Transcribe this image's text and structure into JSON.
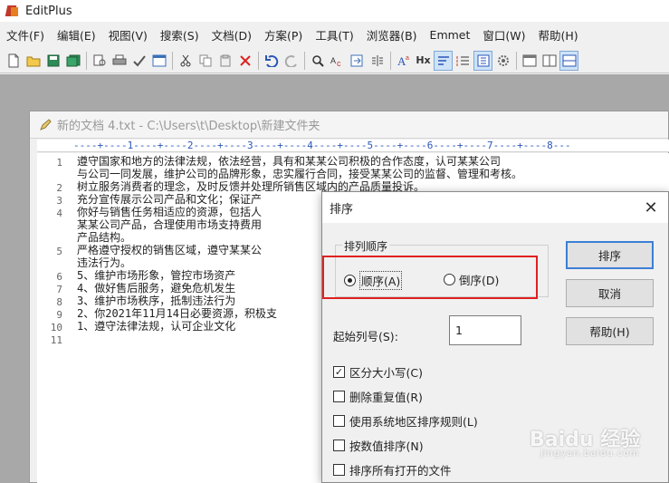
{
  "app": {
    "title": "EditPlus"
  },
  "menu": [
    "文件(F)",
    "编辑(E)",
    "视图(V)",
    "搜索(S)",
    "文档(D)",
    "方案(P)",
    "工具(T)",
    "浏览器(B)",
    "Emmet",
    "窗口(W)",
    "帮助(H)"
  ],
  "toolbar": {
    "hex_label": "Hx",
    "icons": [
      "new-file-icon",
      "open-folder-icon",
      "save-icon",
      "save-all-icon",
      "print-preview-icon",
      "print-icon",
      "spell-check-icon",
      "browser-preview-icon",
      "cut-icon",
      "copy-icon",
      "paste-icon",
      "delete-icon",
      "undo-icon",
      "redo-icon",
      "find-icon",
      "replace-icon",
      "goto-icon",
      "insert-icon",
      "font-icon",
      "hex-icon",
      "wordwrap-icon",
      "line-numbers-icon",
      "column-icon",
      "settings-icon",
      "window-1-icon",
      "window-2-icon",
      "window-3-icon"
    ]
  },
  "document": {
    "title": "新的文档 4.txt - C:\\Users\\t\\Desktop\\新建文件夹",
    "ruler": "----+----1----+----2----+----3----+----4----+----5----+----6----+----7----+----8---",
    "line_numbers": [
      "1",
      "",
      "2",
      "3",
      "4",
      "",
      "",
      "5",
      "",
      "6",
      "7",
      "8",
      "9",
      "10",
      "11"
    ],
    "lines": [
      "遵守国家和地方的法律法规，依法经营，具有和某某公司积极的合作态度，认可某某公司",
      "与公司一同发展，维护公司的品牌形象，忠实履行合同，接受某某公司的监督、管理和考核。",
      "树立服务消费者的理念，及时反馈并处理所销售区域内的产品质量投诉。",
      "充分宣传展示公司产品和文化；保证产",
      "你好与销售任务相适应的资源，包括人",
      "某某公司产品，合理使用市场支持费用",
      "产品结构。",
      "严格遵守授权的销售区域，遵守某某公",
      "违法行为。",
      "5、维护市场形象，管控市场资产",
      "4、做好售后服务，避免危机发生",
      "3、维护市场秩序，抵制违法行为",
      "2、你2021年11月14日必要资源，积极支",
      "1、遵守法律法规，认可企业文化",
      ""
    ]
  },
  "dialog": {
    "title": "排序",
    "order_group_label": "排列顺序",
    "radio_asc": "顺序(A)",
    "radio_desc": "倒序(D)",
    "selected": "asc",
    "start_column_label": "起始列号(S):",
    "start_column_value": "1",
    "buttons": {
      "sort": "排序",
      "cancel": "取消",
      "help": "帮助(H)"
    },
    "checkboxes": [
      {
        "label": "区分大小写(C)",
        "checked": true
      },
      {
        "label": "删除重复值(R)",
        "checked": false
      },
      {
        "label": "使用系统地区排序规则(L)",
        "checked": false
      },
      {
        "label": "按数值排序(N)",
        "checked": false
      },
      {
        "label": "排序所有打开的文件",
        "checked": false
      }
    ]
  },
  "watermark": {
    "brand": "Baidu 经验",
    "sub": "jingyan.baidu.com"
  },
  "colors": {
    "annotation": "#e02020",
    "ruler": "#2a55b8",
    "mdi_background": "#a8a8a8"
  }
}
